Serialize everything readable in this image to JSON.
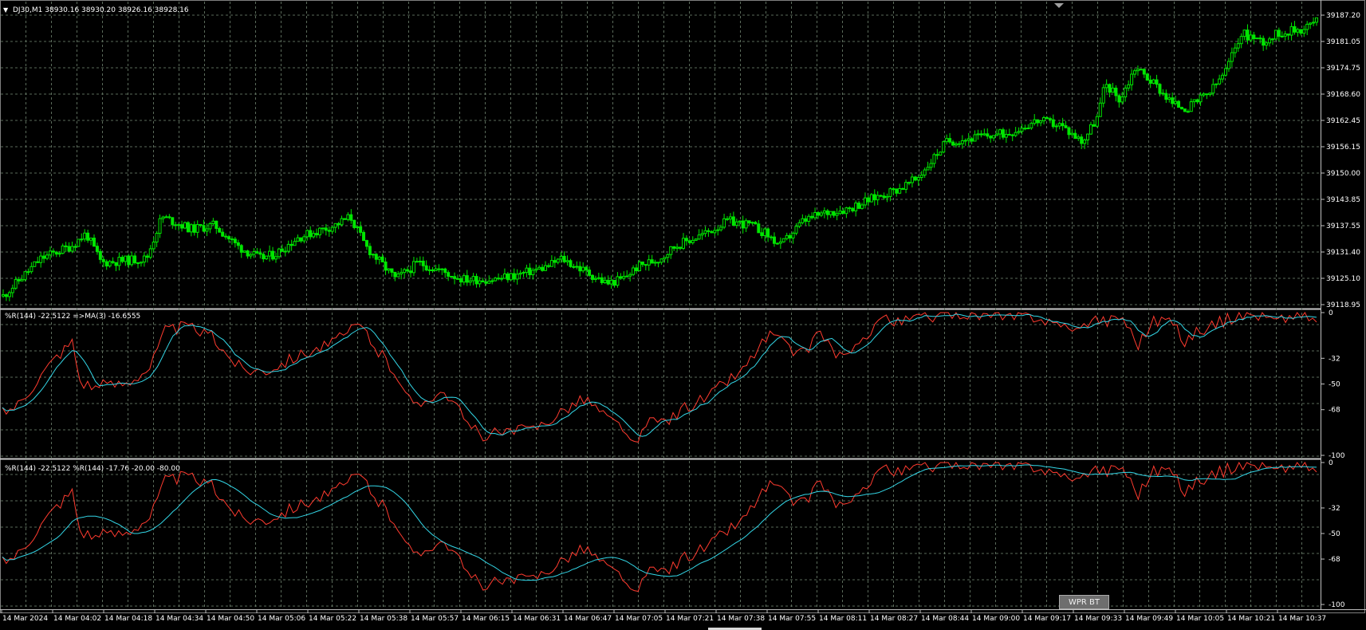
{
  "symbol_header": "DJ30,M1  38930.16 38930.20 38926.16 38928.16",
  "panel1_title": "%R(144) -22.5122  =>MA(3) -16.6555",
  "panel2_title": "%R(144) -22.5122  %R(144) -17.76 -20.00 -80.00",
  "price_axis": [
    "39187.20",
    "39181.05",
    "39174.75",
    "39168.60",
    "39162.45",
    "39156.15",
    "39150.00",
    "39143.85",
    "39137.55",
    "39131.40",
    "39125.10",
    "39118.95"
  ],
  "indicator_axis": [
    "0",
    "-32",
    "-50",
    "-68",
    "-100"
  ],
  "time_labels": [
    "14 Mar 2024",
    "14 Mar 04:02",
    "14 Mar 04:18",
    "14 Mar 04:34",
    "14 Mar 04:50",
    "14 Mar 05:06",
    "14 Mar 05:22",
    "14 Mar 05:38",
    "14 Mar 05:57",
    "14 Mar 06:15",
    "14 Mar 06:31",
    "14 Mar 06:47",
    "14 Mar 07:05",
    "14 Mar 07:21",
    "14 Mar 07:38",
    "14 Mar 07:55",
    "14 Mar 08:11",
    "14 Mar 08:27",
    "14 Mar 08:44",
    "14 Mar 09:00",
    "14 Mar 09:17",
    "14 Mar 09:33",
    "14 Mar 09:49",
    "14 Mar 10:05",
    "14 Mar 10:21",
    "14 Mar 10:37"
  ],
  "button_label": "WPR BT",
  "colors": {
    "candle": "#00e600",
    "wpr": "#ff3b2f",
    "ma": "#33d6e6",
    "grid": "#5a6a5a",
    "text": "#ffffff",
    "separator": "#c8c8c8"
  },
  "chart_data": {
    "type": "line",
    "price_keypoints": [
      [
        0,
        39121
      ],
      [
        5,
        39130
      ],
      [
        9,
        39133
      ],
      [
        11,
        39136
      ],
      [
        13,
        39129
      ],
      [
        19,
        39130
      ],
      [
        21,
        39140
      ],
      [
        25,
        39137
      ],
      [
        28,
        39138
      ],
      [
        31,
        39133
      ],
      [
        34,
        39130
      ],
      [
        36,
        39131
      ],
      [
        39,
        39135
      ],
      [
        44,
        39138
      ],
      [
        46,
        39140
      ],
      [
        48,
        39133
      ],
      [
        52,
        39125
      ],
      [
        55,
        39129
      ],
      [
        58,
        39127
      ],
      [
        61,
        39125
      ],
      [
        65,
        39125
      ],
      [
        68,
        39126
      ],
      [
        72,
        39128
      ],
      [
        74,
        39130
      ],
      [
        77,
        39127
      ],
      [
        80,
        39124
      ],
      [
        82,
        39125
      ],
      [
        84,
        39128
      ],
      [
        87,
        39130
      ],
      [
        89,
        39133
      ],
      [
        93,
        39136
      ],
      [
        96,
        39139
      ],
      [
        99,
        39138
      ],
      [
        101,
        39136
      ],
      [
        103,
        39133
      ],
      [
        106,
        39139
      ],
      [
        109,
        39141
      ],
      [
        112,
        39142
      ],
      [
        116,
        39145
      ],
      [
        119,
        39147
      ],
      [
        121,
        39149
      ],
      [
        125,
        39158
      ],
      [
        129,
        39159
      ],
      [
        133,
        39160
      ],
      [
        137,
        39163
      ],
      [
        140,
        39162
      ],
      [
        143,
        39158
      ],
      [
        145,
        39164
      ],
      [
        146,
        39172
      ],
      [
        148,
        39168
      ],
      [
        150,
        39176
      ],
      [
        153,
        39171
      ],
      [
        155,
        39167
      ],
      [
        157,
        39166
      ],
      [
        160,
        39170
      ],
      [
        162,
        39175
      ],
      [
        164,
        39184
      ],
      [
        167,
        39182
      ],
      [
        169,
        39184
      ],
      [
        172,
        39185
      ],
      [
        174,
        39187
      ]
    ],
    "wpr_keypoints": [
      [
        0,
        -70
      ],
      [
        2,
        -64
      ],
      [
        4,
        -50
      ],
      [
        7,
        -30
      ],
      [
        9,
        -20
      ],
      [
        10,
        -48
      ],
      [
        12,
        -52
      ],
      [
        16,
        -49
      ],
      [
        19,
        -38
      ],
      [
        21,
        -12
      ],
      [
        24,
        -10
      ],
      [
        27,
        -17
      ],
      [
        29,
        -30
      ],
      [
        31,
        -40
      ],
      [
        34,
        -40
      ],
      [
        38,
        -30
      ],
      [
        43,
        -20
      ],
      [
        46,
        -8
      ],
      [
        48,
        -25
      ],
      [
        51,
        -45
      ],
      [
        53,
        -68
      ],
      [
        55,
        -58
      ],
      [
        57,
        -55
      ],
      [
        60,
        -80
      ],
      [
        62,
        -86
      ],
      [
        65,
        -84
      ],
      [
        68,
        -82
      ],
      [
        70,
        -76
      ],
      [
        73,
        -65
      ],
      [
        75,
        -60
      ],
      [
        78,
        -75
      ],
      [
        80,
        -80
      ],
      [
        81,
        -96
      ],
      [
        83,
        -78
      ],
      [
        86,
        -74
      ],
      [
        88,
        -66
      ],
      [
        91,
        -58
      ],
      [
        93,
        -48
      ],
      [
        95,
        -42
      ],
      [
        97,
        -26
      ],
      [
        99,
        -14
      ],
      [
        101,
        -25
      ],
      [
        103,
        -30
      ],
      [
        105,
        -12
      ],
      [
        107,
        -28
      ],
      [
        109,
        -32
      ],
      [
        111,
        -16
      ],
      [
        113,
        -2
      ],
      [
        115,
        -8
      ],
      [
        117,
        -4
      ],
      [
        120,
        -2
      ],
      [
        123,
        0
      ],
      [
        126,
        -2
      ],
      [
        129,
        -4
      ],
      [
        131,
        -3
      ],
      [
        133,
        -2
      ],
      [
        135,
        -8
      ],
      [
        136,
        -6
      ],
      [
        138,
        -16
      ],
      [
        140,
        -3
      ],
      [
        142,
        -6
      ],
      [
        144,
        -2
      ],
      [
        146,
        -22
      ],
      [
        148,
        -6
      ],
      [
        150,
        -4
      ],
      [
        152,
        -20
      ],
      [
        154,
        -12
      ],
      [
        156,
        -8
      ],
      [
        158,
        -4
      ],
      [
        160,
        0
      ],
      [
        162,
        -2
      ],
      [
        164,
        -6
      ],
      [
        166,
        -1
      ],
      [
        168,
        -3
      ],
      [
        169,
        -6
      ]
    ],
    "ma_period": 3,
    "panel2_levels": [
      -20,
      -80
    ],
    "price_ylim": [
      39118.95,
      39190.2
    ],
    "indicator_ylim": [
      -100,
      0
    ]
  }
}
